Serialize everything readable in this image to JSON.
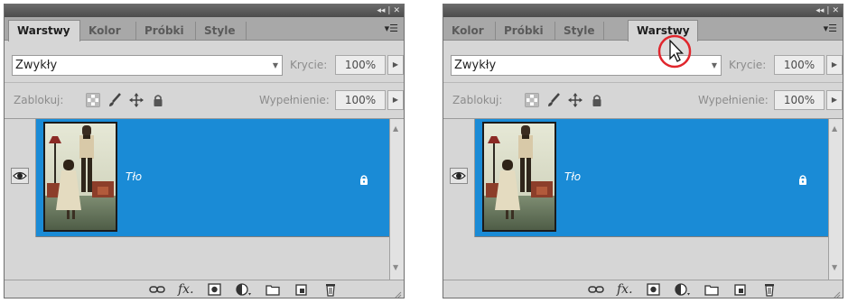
{
  "panels": [
    {
      "tabs": [
        "Warstwy",
        "Kolor",
        "Próbki",
        "Style"
      ],
      "active_tab": "Warstwy",
      "blend_mode": "Zwykły",
      "opacity_label": "Krycie:",
      "opacity_value": "100%",
      "lock_label": "Zablokuj:",
      "fill_label": "Wypełnienie:",
      "fill_value": "100%",
      "layer_name": "Tło"
    },
    {
      "tabs": [
        "Kolor",
        "Próbki",
        "Style",
        "Warstwy"
      ],
      "active_tab": "Warstwy",
      "blend_mode": "Zwykły",
      "opacity_label": "Krycie:",
      "opacity_value": "100%",
      "lock_label": "Zablokuj:",
      "fill_label": "Wypełnienie:",
      "fill_value": "100%",
      "layer_name": "Tło"
    }
  ],
  "titlebar_controls": [
    "◂◂",
    "|",
    "✕"
  ],
  "icons": {
    "eye": "eye-icon",
    "lock": "lock-icon",
    "link": "link-icon",
    "fx": "fx",
    "mask": "mask-icon",
    "adjustment": "adjustment-icon",
    "folder": "folder-icon",
    "new_layer": "new-layer-icon",
    "trash": "trash-icon"
  },
  "colors": {
    "selected_layer": "#1a8bd6",
    "panel_bg": "#d6d6d6",
    "tab_bar": "#a8a8a8",
    "cursor_circle": "#e0262d"
  }
}
